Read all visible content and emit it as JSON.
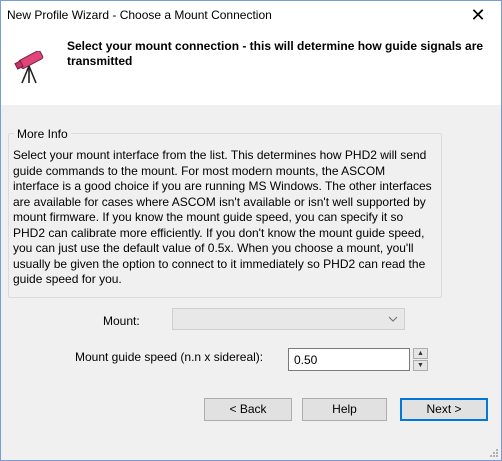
{
  "window": {
    "title": "New Profile Wizard - Choose a Mount Connection",
    "close_glyph": "✕"
  },
  "header": {
    "heading": "Select your mount connection - this will determine how guide signals are transmitted",
    "icon": "telescope-icon"
  },
  "more_info": {
    "title": "More Info",
    "text": "Select your mount interface from the list.  This determines how PHD2 will send guide commands to the mount. For most modern mounts, the ASCOM interface is a good choice if you are running MS Windows.  The other interfaces are available for cases where ASCOM isn't available or isn't well supported by mount firmware.  If you know the mount guide speed, you can specify it  so PHD2 can calibrate more efficiently.  If you don't know the mount guide speed, you can just use the default value of 0.5x.  When you choose a  mount, you'll usually be given the option to connect to it immediately so PHD2 can read the guide speed for you."
  },
  "form": {
    "mount_label": "Mount:",
    "mount_value": "",
    "speed_label": "Mount guide speed (n.n x sidereal):",
    "speed_value": "0.50"
  },
  "buttons": {
    "back": "< Back",
    "help": "Help",
    "next": "Next >"
  }
}
